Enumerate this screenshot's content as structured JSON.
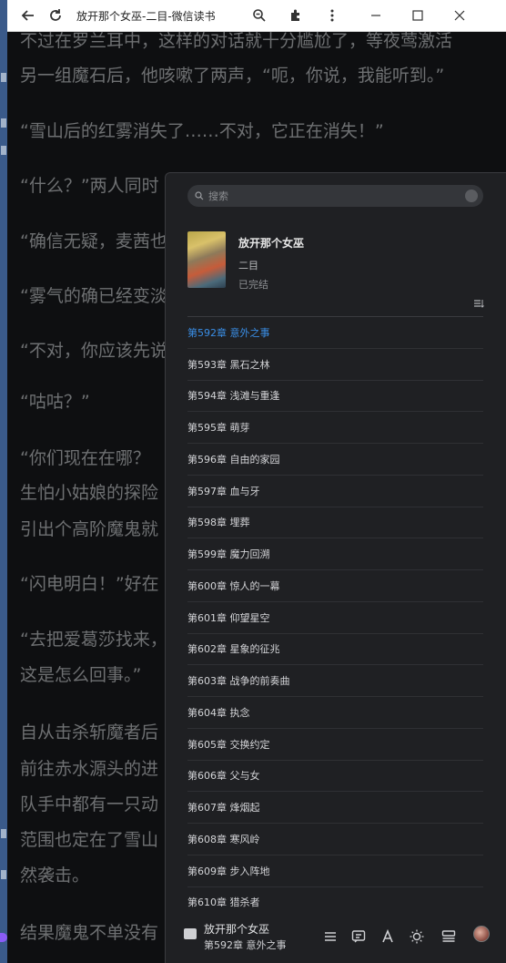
{
  "window": {
    "title": "放开那个女巫-二目-微信读书"
  },
  "reader": {
    "lines": [
      "不过在罗兰耳中，这样的对话就十分尴尬了，等夜莺激活",
      "另一组魔石后，他咳嗽了两声，“呃，你说，我能听到。”",
      "“雪山后的红雾消失了……不对，它正在消失！”",
      "“什么？”两人同时",
      "“确信无疑，麦茜也",
      "“雾气的确已经变淡",
      "“不对，你应该先说",
      "“咕咕？”",
      "“你们现在在哪？",
      "生怕小姑娘的探险",
      "引出个高阶魔鬼就",
      "“闪电明白！”好在",
      "“去把爱葛莎找来，",
      "这是怎么回事。”",
      "自从击杀斩魔者后",
      "前往赤水源头的进",
      "队手中都有一只动",
      "范围也定在了雪山",
      "然袭击。",
      "结果魔鬼不单没有"
    ]
  },
  "toc": {
    "search_placeholder": "搜索",
    "book": {
      "title": "放开那个女巫",
      "author": "二目",
      "status": "已完结"
    },
    "chapters": [
      {
        "label": "第592章 意外之事",
        "active": true
      },
      {
        "label": "第593章 黑石之林",
        "active": false
      },
      {
        "label": "第594章 浅滩与重逢",
        "active": false
      },
      {
        "label": "第595章 萌芽",
        "active": false
      },
      {
        "label": "第596章 自由的家园",
        "active": false
      },
      {
        "label": "第597章 血与牙",
        "active": false
      },
      {
        "label": "第598章 埋葬",
        "active": false
      },
      {
        "label": "第599章 魔力回溯",
        "active": false
      },
      {
        "label": "第600章 惊人的一幕",
        "active": false
      },
      {
        "label": "第601章 仰望星空",
        "active": false
      },
      {
        "label": "第602章 星象的征兆",
        "active": false
      },
      {
        "label": "第603章 战争的前奏曲",
        "active": false
      },
      {
        "label": "第604章 执念",
        "active": false
      },
      {
        "label": "第605章 交换约定",
        "active": false
      },
      {
        "label": "第606章 父与女",
        "active": false
      },
      {
        "label": "第607章 烽烟起",
        "active": false
      },
      {
        "label": "第608章 寒风岭",
        "active": false
      },
      {
        "label": "第609章 步入阵地",
        "active": false
      },
      {
        "label": "第610章 猎杀者",
        "active": false
      }
    ]
  },
  "bottom_bar": {
    "book_name": "放开那个女巫",
    "current_chapter": "第592章 意外之事",
    "tools": [
      "menu-icon",
      "comment-icon",
      "font-icon",
      "brightness-icon",
      "layout-icon",
      "avatar"
    ]
  },
  "colors": {
    "accent": "#3a8ee6",
    "panel_bg": "#1f2023",
    "reader_bg": "#0e0f11",
    "reader_text": "#6e7072"
  }
}
